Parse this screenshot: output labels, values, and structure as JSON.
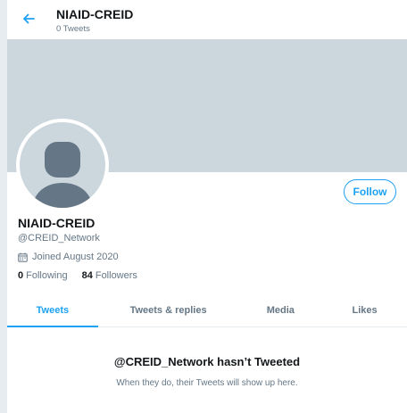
{
  "header": {
    "title": "NIAID-CREID",
    "tweet_count": "0 Tweets"
  },
  "profile": {
    "name": "NIAID-CREID",
    "handle": "@CREID_Network",
    "joined": "Joined August 2020",
    "following_count": "0",
    "following_label": "Following",
    "followers_count": "84",
    "followers_label": "Followers",
    "follow_label": "Follow"
  },
  "tabs": [
    {
      "label": "Tweets",
      "active": true
    },
    {
      "label": "Tweets & replies",
      "active": false
    },
    {
      "label": "Media",
      "active": false
    },
    {
      "label": "Likes",
      "active": false
    }
  ],
  "empty_state": {
    "title": "@CREID_Network hasn’t Tweeted",
    "subtitle": "When they do, their Tweets will show up here."
  },
  "colors": {
    "accent": "#1da1f2",
    "banner": "#ccd6dd",
    "avatar_silhouette": "#657786"
  },
  "icons": [
    "back-arrow-icon",
    "calendar-icon",
    "default-avatar-icon"
  ]
}
